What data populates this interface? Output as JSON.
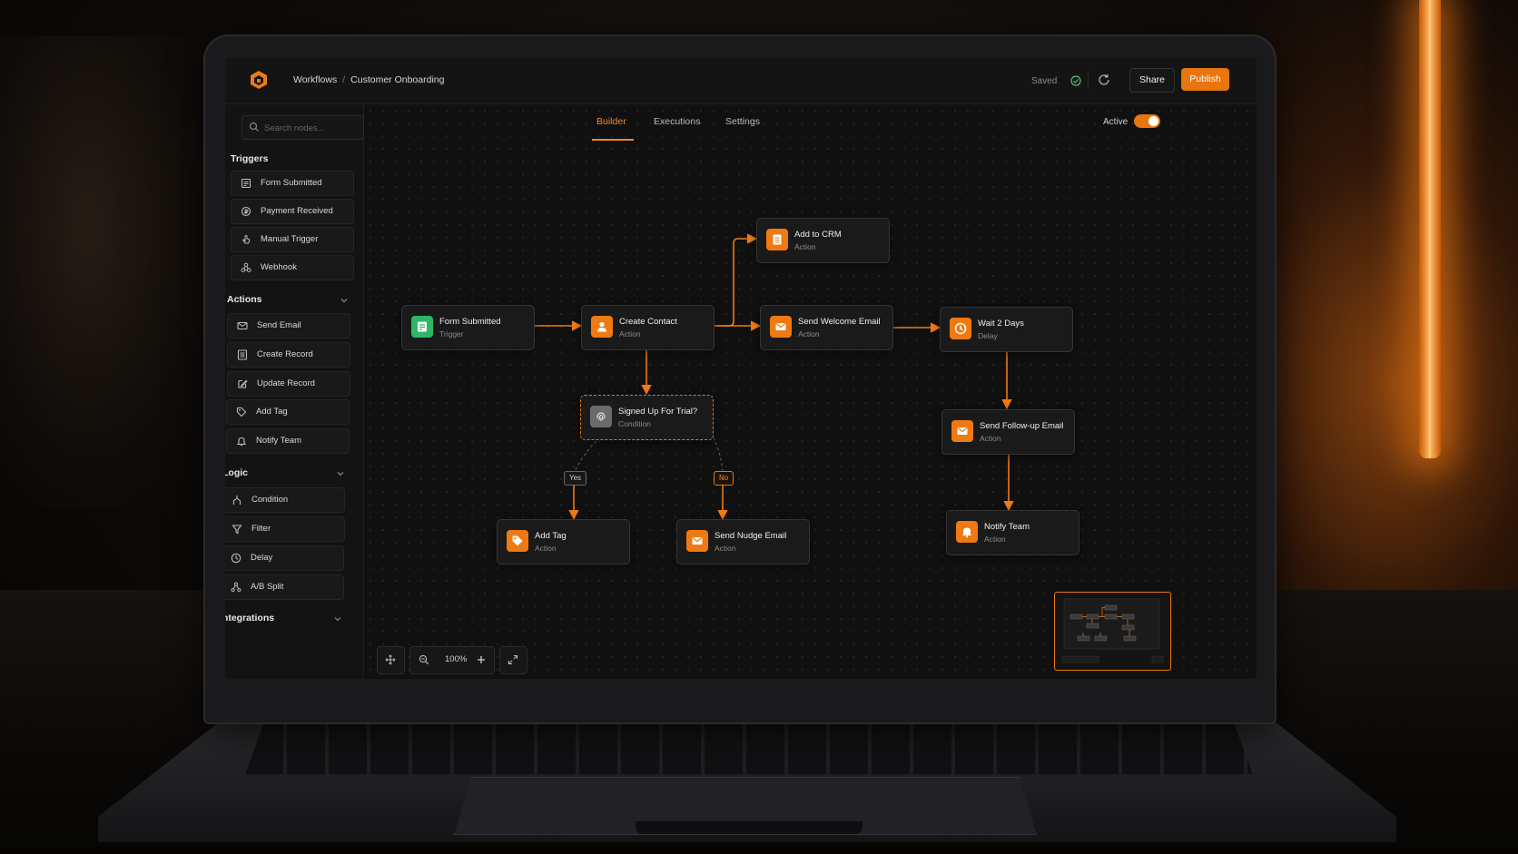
{
  "app": {
    "breadcrumb": {
      "root": "Workflows",
      "separator": "/",
      "current": "Customer Onboarding"
    },
    "status": "Saved",
    "share_label": "Share",
    "publish_label": "Publish",
    "accent_color": "#e8750e"
  },
  "search": {
    "placeholder": "Search nodes..."
  },
  "sidebar": {
    "triggers": {
      "title": "Triggers",
      "items": [
        {
          "label": "Form Submitted",
          "icon": "form-icon"
        },
        {
          "label": "Payment Received",
          "icon": "payment-icon"
        },
        {
          "label": "Manual Trigger",
          "icon": "hand-icon"
        },
        {
          "label": "Webhook",
          "icon": "webhook-icon"
        }
      ]
    },
    "actions": {
      "title": "Actions",
      "items": [
        {
          "label": "Send Email",
          "icon": "mail-icon"
        },
        {
          "label": "Create Record",
          "icon": "record-icon"
        },
        {
          "label": "Update Record",
          "icon": "edit-icon"
        },
        {
          "label": "Add Tag",
          "icon": "tag-icon"
        },
        {
          "label": "Notify Team",
          "icon": "bell-icon"
        }
      ]
    },
    "logic": {
      "title": "Logic",
      "items": [
        {
          "label": "Condition",
          "icon": "condition-icon"
        },
        {
          "label": "Filter",
          "icon": "filter-icon"
        },
        {
          "label": "Delay",
          "icon": "clock-icon"
        },
        {
          "label": "A/B Split",
          "icon": "split-icon"
        }
      ]
    },
    "integrations": {
      "title": "Integrations"
    }
  },
  "tabs": [
    "Builder",
    "Executions",
    "Settings"
  ],
  "active_tab": "Builder",
  "active_toggle": {
    "label": "Active",
    "on": true
  },
  "nodes": {
    "form_submitted": {
      "title": "Form Submitted",
      "sub": "Trigger",
      "icon": "form-icon"
    },
    "create_contact": {
      "title": "Create Contact",
      "sub": "Action",
      "icon": "user-icon"
    },
    "add_to_crm": {
      "title": "Add to CRM",
      "sub": "Action",
      "icon": "record-icon"
    },
    "send_welcome": {
      "title": "Send Welcome Email",
      "sub": "Action",
      "icon": "mail-icon"
    },
    "wait_2_days": {
      "title": "Wait 2 Days",
      "sub": "Delay",
      "icon": "clock-icon"
    },
    "condition": {
      "title": "Signed Up For Trial?",
      "sub": "Condition",
      "icon": "fingerprint-icon"
    },
    "send_followup": {
      "title": "Send Follow-up Email",
      "sub": "Action",
      "icon": "mail-icon"
    },
    "add_tag": {
      "title": "Add Tag",
      "sub": "Action",
      "icon": "tag-icon"
    },
    "send_nudge": {
      "title": "Send Nudge Email",
      "sub": "Action",
      "icon": "mail-icon"
    },
    "notify_team": {
      "title": "Notify Team",
      "sub": "Action",
      "icon": "bell-icon"
    }
  },
  "branches": {
    "yes": "Yes",
    "no": "No"
  },
  "zoom": {
    "value": "100%"
  }
}
